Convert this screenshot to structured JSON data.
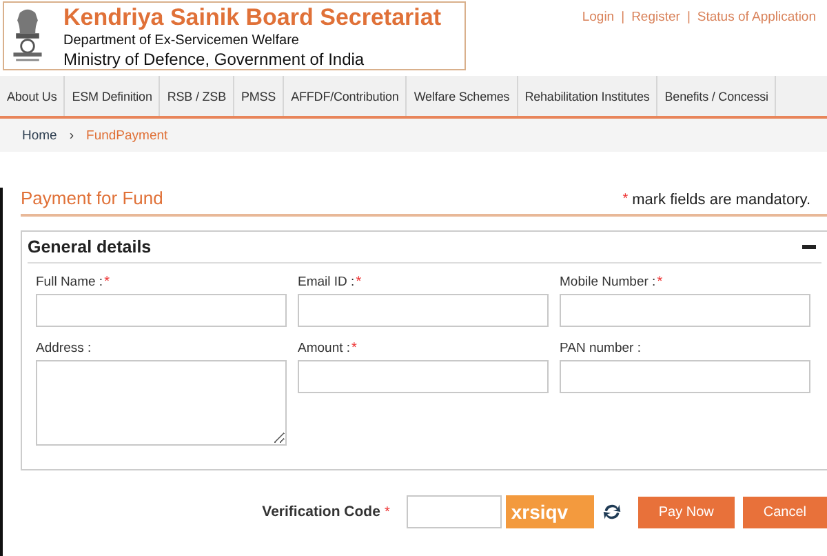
{
  "header": {
    "title": "Kendriya Sainik Board Secretariat",
    "subtitle": "Department of Ex-Servicemen Welfare",
    "ministry": "Ministry of Defence, Government of India"
  },
  "top_links": [
    {
      "label": "Login",
      "separator": "|"
    },
    {
      "label": "Register",
      "separator": "|"
    },
    {
      "label": "Status of Application"
    }
  ],
  "nav": [
    {
      "label": "About Us"
    },
    {
      "label": "ESM Definition"
    },
    {
      "label": "RSB / ZSB"
    },
    {
      "label": "PMSS"
    },
    {
      "label": "AFFDF/Contribution"
    },
    {
      "label": "Welfare Schemes"
    },
    {
      "label": "Rehabilitation Institutes"
    },
    {
      "label": "Benefits / Concessi"
    }
  ],
  "breadcrumb": {
    "home": "Home",
    "separator": "›",
    "current": "FundPayment"
  },
  "page_title": "Payment for Fund",
  "mandatory_note": {
    "mark": "*",
    "text": "mark fields are mandatory."
  },
  "panel": {
    "title": "General details",
    "expanded": true,
    "fields": [
      {
        "label": "Full Name :",
        "required": true,
        "kind": "input"
      },
      {
        "label": "Email ID :",
        "required": true,
        "kind": "input"
      },
      {
        "label": "Mobile Number :",
        "required": true,
        "kind": "input"
      },
      {
        "label": "Address :",
        "required": false,
        "kind": "textarea"
      },
      {
        "label": "Amount :",
        "required": true,
        "kind": "input"
      },
      {
        "label": "PAN number :",
        "required": false,
        "kind": "input"
      }
    ]
  },
  "verification": {
    "label": "Verification Code",
    "required": true,
    "captcha": "xrsiqv"
  },
  "buttons": [
    "Pay Now",
    "Cancel"
  ]
}
